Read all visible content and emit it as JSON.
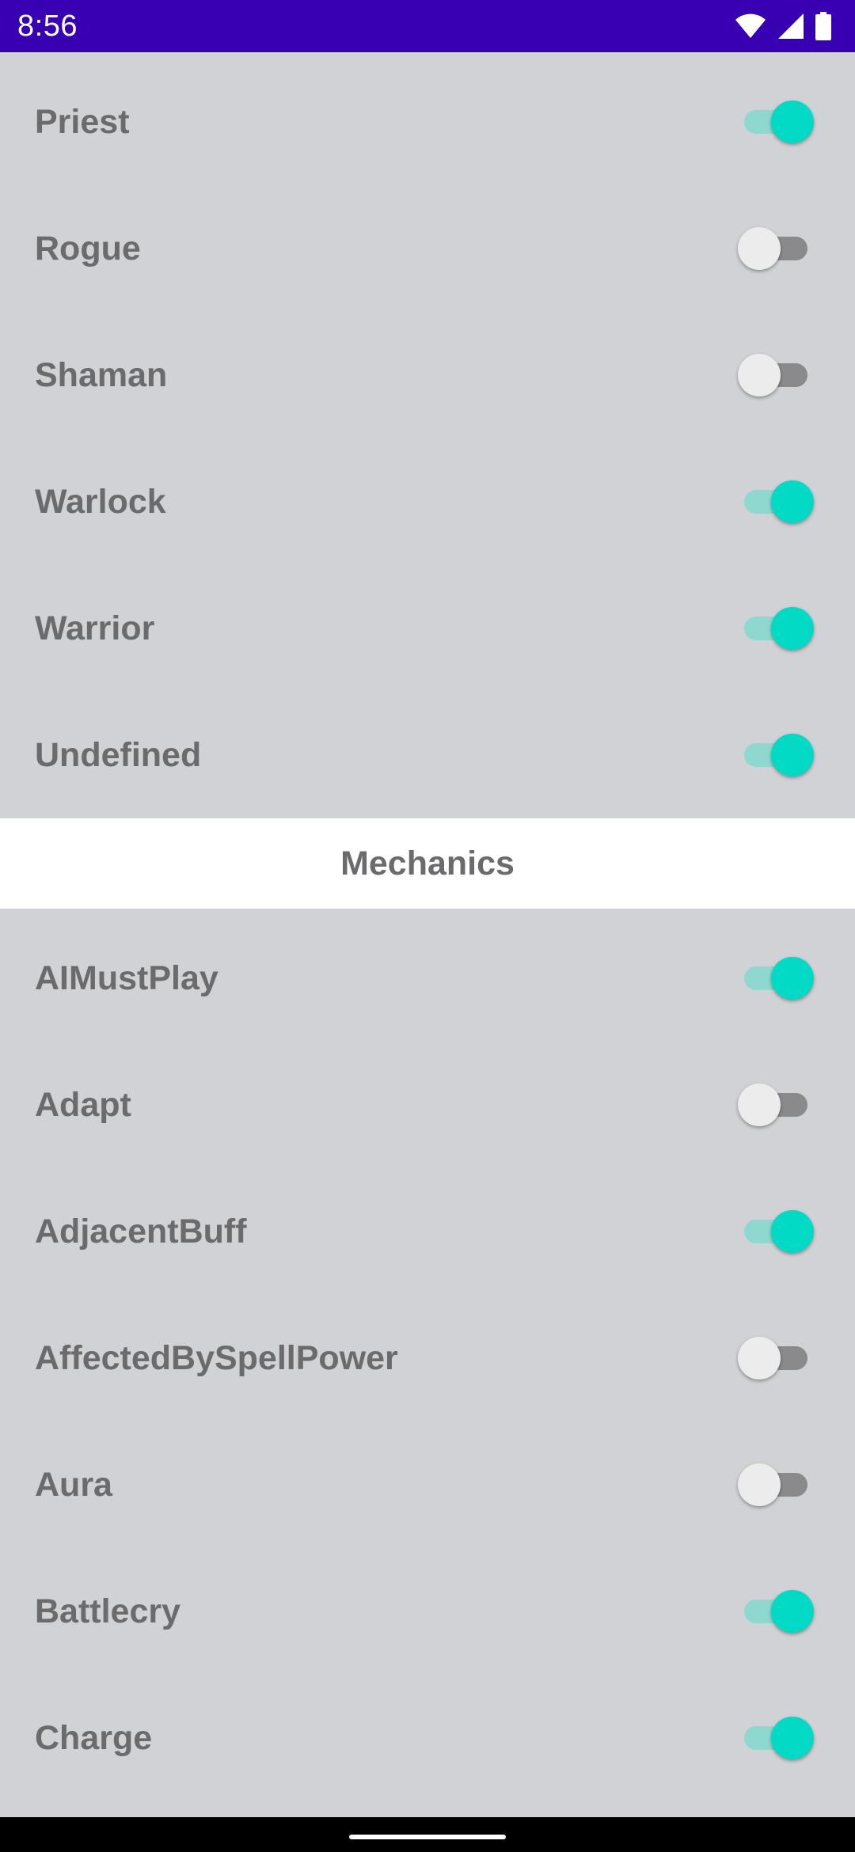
{
  "status_bar": {
    "time": "8:56",
    "icons": [
      "wifi-icon",
      "cell-signal-icon",
      "battery-icon"
    ],
    "background": "#3700b3"
  },
  "colors": {
    "toggle_on_thumb": "#03dac5",
    "toggle_on_track": "#8fd8cf",
    "toggle_off_thumb": "#ececec",
    "toggle_off_track": "#8a8a8c",
    "list_background": "#d1d2d6",
    "label_text": "#6b6b6e"
  },
  "classes": [
    {
      "label": "Priest",
      "enabled": true
    },
    {
      "label": "Rogue",
      "enabled": false
    },
    {
      "label": "Shaman",
      "enabled": false
    },
    {
      "label": "Warlock",
      "enabled": true
    },
    {
      "label": "Warrior",
      "enabled": true
    },
    {
      "label": "Undefined",
      "enabled": true
    }
  ],
  "mechanics": {
    "header": "Mechanics",
    "items": [
      {
        "label": "AIMustPlay",
        "enabled": true
      },
      {
        "label": "Adapt",
        "enabled": false
      },
      {
        "label": "AdjacentBuff",
        "enabled": true
      },
      {
        "label": "AffectedBySpellPower",
        "enabled": false
      },
      {
        "label": "Aura",
        "enabled": false
      },
      {
        "label": "Battlecry",
        "enabled": true
      },
      {
        "label": "Charge",
        "enabled": true
      }
    ]
  }
}
